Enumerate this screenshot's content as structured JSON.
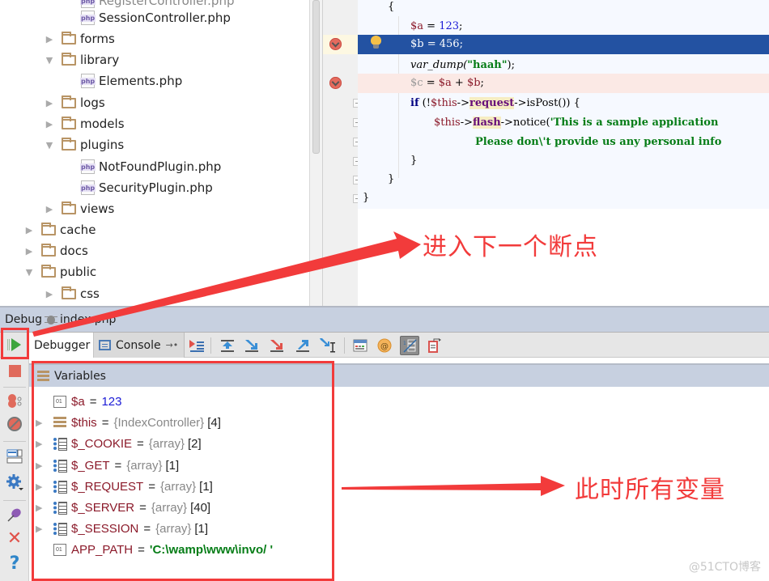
{
  "tree": {
    "items": [
      {
        "label": "RegisterController.php",
        "type": "file",
        "expanded": null
      },
      {
        "label": "SessionController.php",
        "type": "file",
        "expanded": null
      },
      {
        "label": "forms",
        "type": "folder",
        "expanded": false
      },
      {
        "label": "library",
        "type": "folder",
        "expanded": true
      },
      {
        "label": "Elements.php",
        "type": "file",
        "expanded": null
      },
      {
        "label": "logs",
        "type": "folder",
        "expanded": false
      },
      {
        "label": "models",
        "type": "folder",
        "expanded": false
      },
      {
        "label": "plugins",
        "type": "folder",
        "expanded": true
      },
      {
        "label": "NotFoundPlugin.php",
        "type": "file",
        "expanded": null
      },
      {
        "label": "SecurityPlugin.php",
        "type": "file",
        "expanded": null
      },
      {
        "label": "views",
        "type": "folder",
        "expanded": false
      },
      {
        "label": "cache",
        "type": "folder",
        "expanded": false
      },
      {
        "label": "docs",
        "type": "folder",
        "expanded": false
      },
      {
        "label": "public",
        "type": "folder",
        "expanded": true
      },
      {
        "label": "css",
        "type": "folder",
        "expanded": false
      }
    ],
    "php_badge": "php"
  },
  "editor": {
    "lines": {
      "open_brace": "{",
      "a_var": "$a",
      "a_eq": " = ",
      "a_val": "123",
      "a_end": ";",
      "b_var": "$b",
      "b_eq": " = ",
      "b_val": "456",
      "b_end": ";",
      "dump_fn": "var_dump(",
      "dump_str": "\"haah\"",
      "dump_end": ");",
      "c_var": "$c",
      "c_eq": " = ",
      "c_a": "$a",
      "c_plus": " + ",
      "c_b": "$b",
      "c_end": ";",
      "if_kw": "if",
      "if_open": " (!",
      "if_this": "$this",
      "if_arrow": "->",
      "if_field": "request",
      "if_rest": "->isPost()) {",
      "flash_this": "$this",
      "flash_arrow": "->",
      "flash_field": "flash",
      "flash_rest": "->notice(",
      "flash_str": "'This is a sample application",
      "please_str": "Please don\\'t provide us any personal info",
      "close_inner": "}",
      "close_mid": "}",
      "close_outer": "}"
    }
  },
  "debug": {
    "title": "Debug",
    "config_name": "index.php",
    "tabs": [
      {
        "label": "Debugger",
        "active": true
      },
      {
        "label": "Console",
        "active": false
      }
    ],
    "toolbar_icons": [
      "show-execution-point-icon",
      "step-over-icon",
      "step-into-icon",
      "force-step-into-icon",
      "step-out-icon",
      "run-to-cursor-icon",
      "evaluate-expression-icon",
      "watch-icon",
      "show-values-inline-icon",
      "restore-layout-icon"
    ],
    "left_icons": [
      "resume-icon",
      "stop-icon",
      "view-breakpoints-icon",
      "mute-breakpoints-icon",
      "layout-icon",
      "settings-icon",
      "pin-icon",
      "close-icon",
      "help-icon"
    ]
  },
  "variables": {
    "header": "Variables",
    "rows": [
      {
        "name": "$a",
        "eq": "=",
        "value": "123",
        "kind": "number",
        "expandable": false
      },
      {
        "name": "$this",
        "eq": "=",
        "type": "{IndexController}",
        "count": "[4]",
        "kind": "object",
        "expandable": true
      },
      {
        "name": "$_COOKIE",
        "eq": "=",
        "type": "{array}",
        "count": "[2]",
        "kind": "array",
        "expandable": true
      },
      {
        "name": "$_GET",
        "eq": "=",
        "type": "{array}",
        "count": "[1]",
        "kind": "array",
        "expandable": true
      },
      {
        "name": "$_REQUEST",
        "eq": "=",
        "type": "{array}",
        "count": "[1]",
        "kind": "array",
        "expandable": true
      },
      {
        "name": "$_SERVER",
        "eq": "=",
        "type": "{array}",
        "count": "[40]",
        "kind": "array",
        "expandable": true
      },
      {
        "name": "$_SESSION",
        "eq": "=",
        "type": "{array}",
        "count": "[1]",
        "kind": "array",
        "expandable": true
      },
      {
        "name": "APP_PATH",
        "eq": "=",
        "value": "'C:\\wamp\\www\\invo/ '",
        "kind": "string",
        "expandable": false
      }
    ]
  },
  "annotations": {
    "next_breakpoint": "进入下一个断点",
    "all_variables": "此时所有变量",
    "color": "#f23b3b"
  },
  "watermark": "@51CTO博客"
}
